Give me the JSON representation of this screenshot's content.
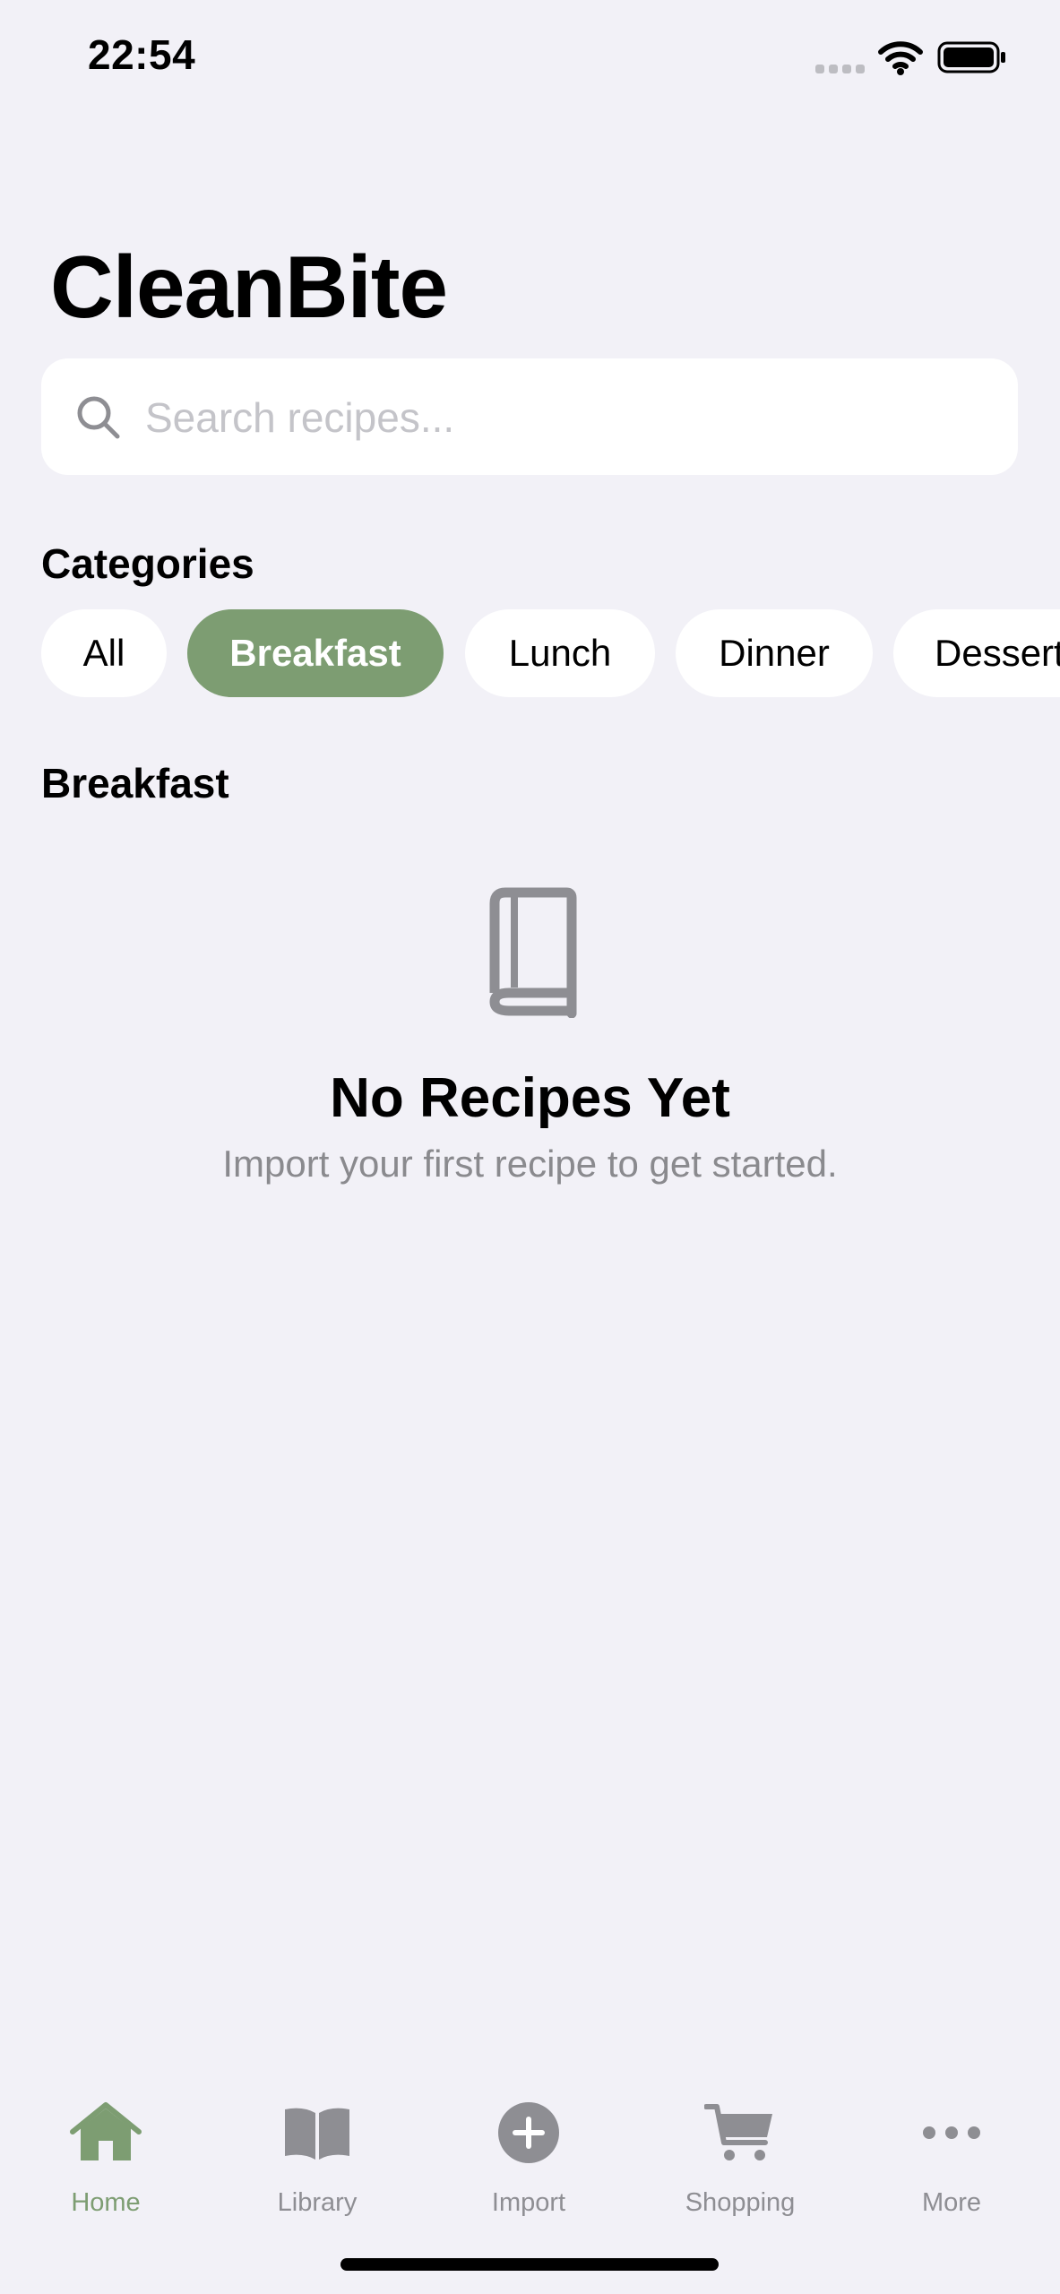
{
  "status_bar": {
    "time": "22:54"
  },
  "app": {
    "title": "CleanBite"
  },
  "search": {
    "placeholder": "Search recipes..."
  },
  "categories": {
    "heading": "Categories",
    "items": [
      "All",
      "Breakfast",
      "Lunch",
      "Dinner",
      "Dessert"
    ],
    "selected": "Breakfast"
  },
  "section": {
    "title": "Breakfast"
  },
  "empty_state": {
    "icon": "book-icon",
    "title": "No Recipes Yet",
    "subtitle": "Import your first recipe to get started."
  },
  "tab_bar": {
    "items": [
      {
        "label": "Home",
        "icon": "house-icon"
      },
      {
        "label": "Library",
        "icon": "open-book-icon"
      },
      {
        "label": "Import",
        "icon": "plus-circle-icon"
      },
      {
        "label": "Shopping",
        "icon": "cart-icon"
      },
      {
        "label": "More",
        "icon": "ellipsis-icon"
      }
    ],
    "active": "Home"
  },
  "colors": {
    "accent": "#7D9D72",
    "background": "#F2F1F7",
    "inactive": "#8E8E93"
  }
}
